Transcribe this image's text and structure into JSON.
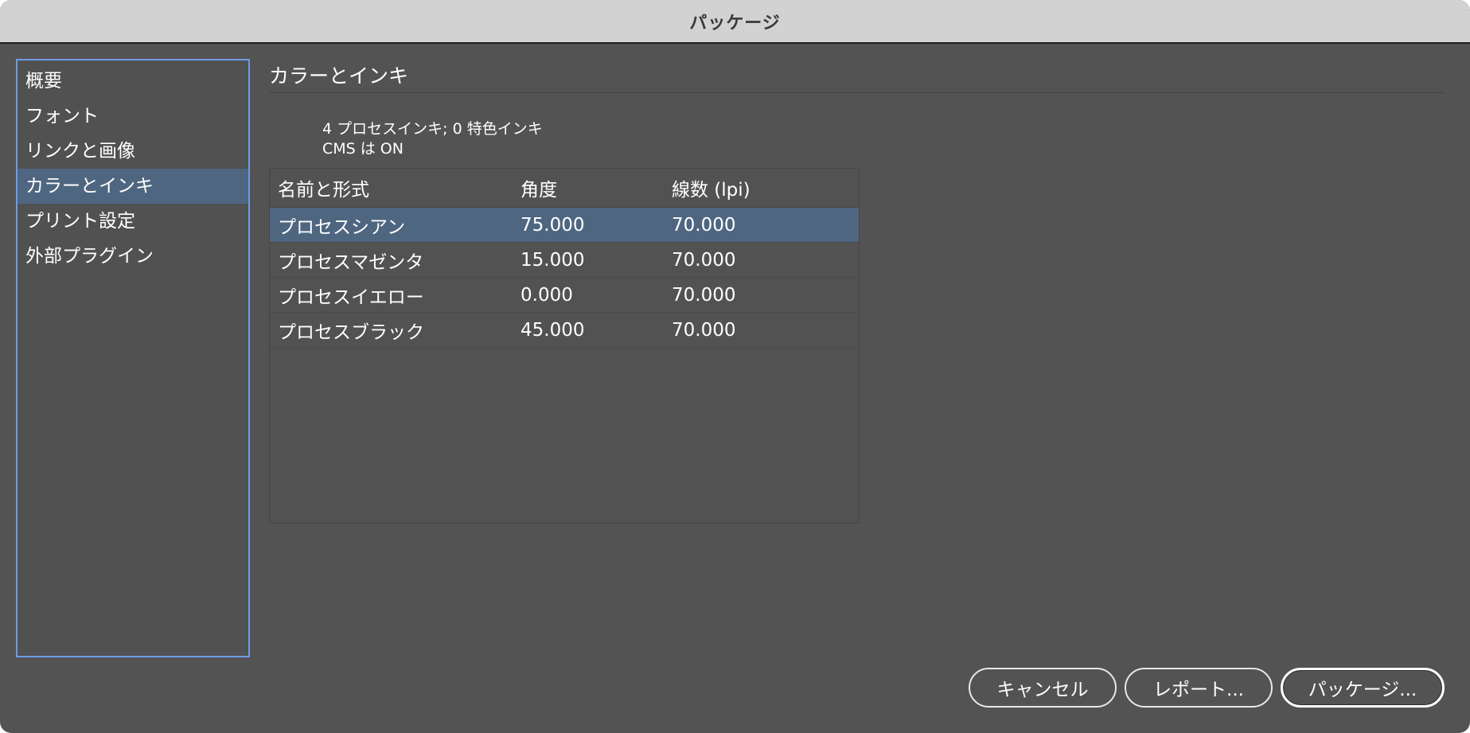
{
  "window": {
    "title": "パッケージ"
  },
  "sidebar": {
    "items": [
      {
        "label": "概要"
      },
      {
        "label": "フォント"
      },
      {
        "label": "リンクと画像"
      },
      {
        "label": "カラーとインキ",
        "selected": true
      },
      {
        "label": "プリント設定"
      },
      {
        "label": "外部プラグイン"
      }
    ]
  },
  "main": {
    "section_title": "カラーとインキ",
    "summary_line1": "4 プロセスインキ; 0 特色インキ",
    "summary_line2": "CMS は ON",
    "table": {
      "headers": {
        "name": "名前と形式",
        "angle": "角度",
        "lpi": "線数 (lpi)"
      },
      "rows": [
        {
          "name": "プロセスシアン",
          "angle": "75.000",
          "lpi": "70.000",
          "selected": true
        },
        {
          "name": "プロセスマゼンタ",
          "angle": "15.000",
          "lpi": "70.000"
        },
        {
          "name": "プロセスイエロー",
          "angle": "0.000",
          "lpi": "70.000"
        },
        {
          "name": "プロセスブラック",
          "angle": "45.000",
          "lpi": "70.000"
        }
      ]
    }
  },
  "buttons": {
    "cancel": "キャンセル",
    "report": "レポート...",
    "package": "パッケージ..."
  },
  "colors": {
    "background": "#535353",
    "selection": "#4f6680",
    "focus_ring": "#6d9ce6",
    "titlebar": "#d2d2d2"
  }
}
